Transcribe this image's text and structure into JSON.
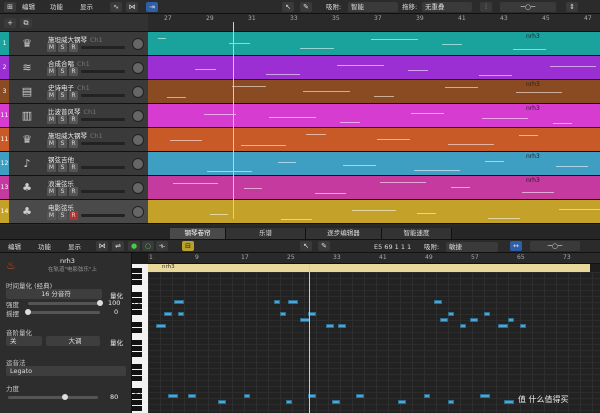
{
  "top_toolbar": {
    "menu_edit": "编辑",
    "menu_function": "功能",
    "menu_view": "显示",
    "snap_label": "吸附:",
    "snap_value": "智能",
    "drag_label": "拖移:",
    "drag_value": "无重叠"
  },
  "tracks_ruler": {
    "bars": [
      "27",
      "29",
      "31",
      "33",
      "35",
      "37",
      "39",
      "41",
      "43",
      "45",
      "47"
    ]
  },
  "tracks": [
    {
      "num": "1",
      "name": "施坦威大钢琴",
      "channel": "Ch1",
      "color": "#1aa39c",
      "icon": "piano-icon",
      "region_label": "nrh3"
    },
    {
      "num": "2",
      "name": "合成合唱",
      "channel": "Ch1",
      "color": "#9b2fd4",
      "icon": "synth-icon",
      "region_label": ""
    },
    {
      "num": "3",
      "name": "史诗电子",
      "channel": "Ch1",
      "color": "#8a4a22",
      "icon": "keyboard-icon",
      "region_label": "nrh3"
    },
    {
      "num": "11",
      "name": "比波普风琴",
      "channel": "Ch1",
      "color": "#d63cd0",
      "icon": "organ-icon",
      "region_label": "nrh3"
    },
    {
      "num": "11",
      "name": "施坦威大钢琴",
      "channel": "Ch1",
      "color": "#c85a28",
      "icon": "piano-icon",
      "region_label": ""
    },
    {
      "num": "12",
      "name": "钢弦吉他",
      "channel": "",
      "color": "#3f9fc2",
      "icon": "guitar-icon",
      "region_label": "nrh3"
    },
    {
      "num": "13",
      "name": "浪漫弦乐",
      "channel": "",
      "color": "#c43a9e",
      "icon": "strings-icon",
      "region_label": "nrh3"
    },
    {
      "num": "14",
      "name": "电影弦乐",
      "channel": "",
      "color": "#c4a22a",
      "icon": "strings-icon",
      "region_label": ""
    }
  ],
  "msr": {
    "m": "M",
    "s": "S",
    "r": "R"
  },
  "editor_tabs": [
    "钢琴卷帘",
    "乐谱",
    "逐步编辑器",
    "智能速度"
  ],
  "editor_toolbar": {
    "menu_edit": "编辑",
    "menu_function": "功能",
    "menu_view": "显示",
    "position": "E5  69 1 1 1",
    "snap_label": "吸附:",
    "snap_value": "敏捷"
  },
  "editor_ruler": {
    "bars": [
      "1",
      "9",
      "17",
      "25",
      "33",
      "41",
      "49",
      "57",
      "65",
      "73"
    ],
    "region_label": "nrh3"
  },
  "inspector": {
    "region_name": "nrh3",
    "region_sub": "在轨道\"电影弦乐\"上",
    "time_quant_label": "时间量化 (经典)",
    "time_quant_value": "16 分音符",
    "quantize_btn": "量化",
    "strength_label": "强度",
    "strength_value": "100",
    "swing_label": "摇摆",
    "swing_value": "0",
    "pitch_quant_label": "音阶量化",
    "pitch_quant_off": "关",
    "pitch_quant_scale": "大调",
    "pitch_quant_btn": "量化",
    "articulation_label": "运音法",
    "articulation_value": "Legato",
    "velocity_label": "力度",
    "velocity_value": "80"
  },
  "piano_labels": {
    "c5": "C5",
    "c4": "C4"
  },
  "watermark": "值 什么值得买"
}
